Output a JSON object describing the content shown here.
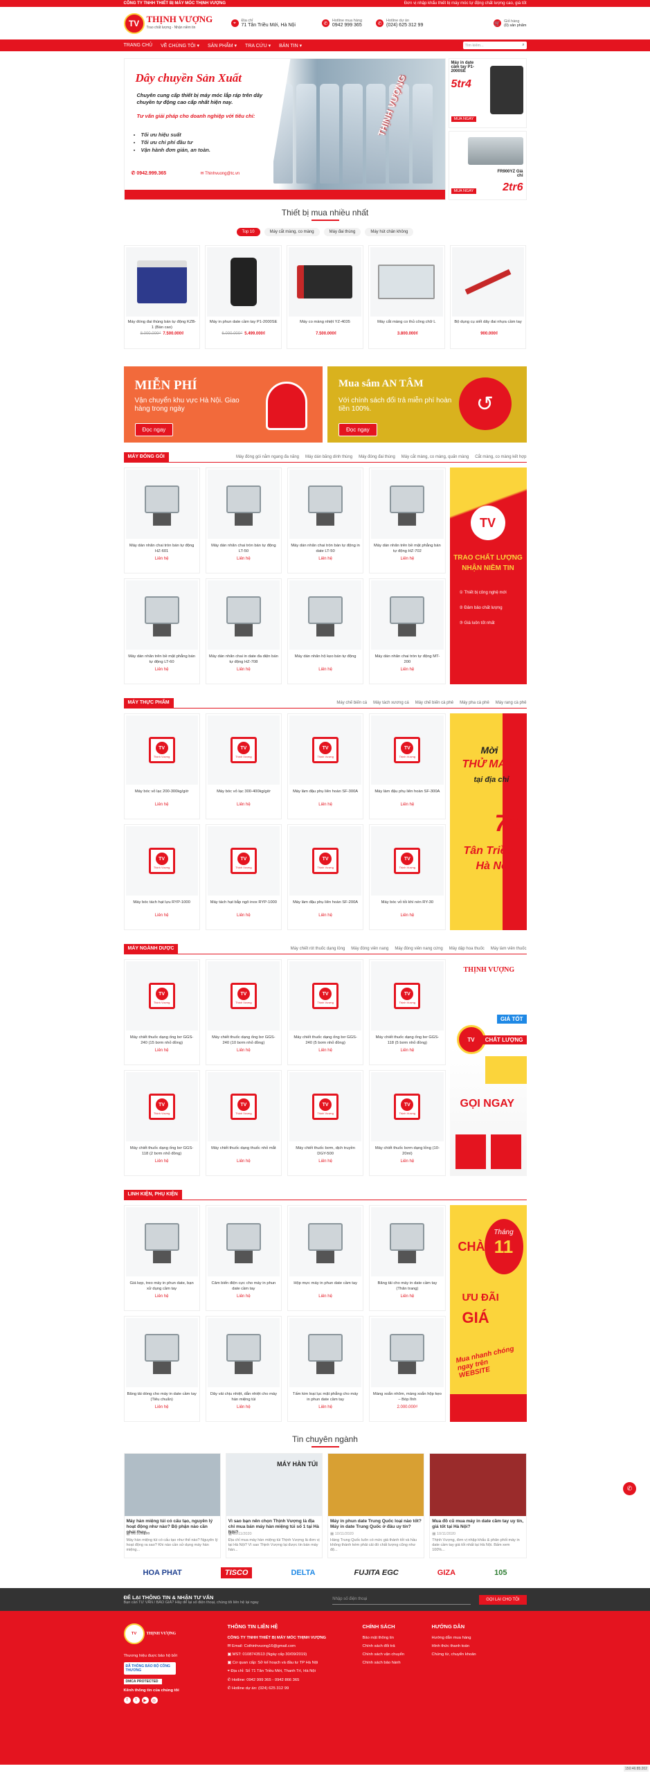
{
  "topbar": {
    "company": "CÔNG TY TNHH THIẾT BỊ MÁY MÓC THỊNH VƯỢNG",
    "slogan": "Đơn vị nhập khẩu thiết bị máy móc tự động chất lượng cao, giá tốt"
  },
  "logo": {
    "text": "THỊNH VƯỢNG",
    "sub": "Trao chất lượng - Nhận niềm tin"
  },
  "header": {
    "address_label": "Địa chỉ",
    "address": "71 Tân Triều Mới, Hà Nội",
    "hotline_label": "Hotline mua hàng",
    "hotline": "0942 999 365",
    "hotline2_label": "Hotline dự án",
    "hotline2": "(024) 625 312 99",
    "cart_label": "Giỏ hàng",
    "cart_count": "(0) sản phẩm"
  },
  "nav": {
    "items": [
      "TRANG CHỦ",
      "VỀ CHÚNG TÔI ▾",
      "SẢN PHẨM ▾",
      "TRA CỨU ▾",
      "BẢN TIN ▾"
    ],
    "search_placeholder": "Tìm kiếm..."
  },
  "banner": {
    "title": "Dây chuyền Sản Xuất",
    "desc1": "Chuyên cung cấp thiết bị máy móc lắp ráp trên dây chuyền tự động cao cấp nhất hiện nay.",
    "desc2": "Tư vấn giải pháp cho doanh nghiệp với tiêu chí:",
    "bullets": [
      "Tối ưu hiệu suất",
      "Tối ưu chi phí đầu tư",
      "Vận hành đơn giản, an toàn."
    ],
    "phone": "0942.999.365",
    "email": "Thinhvuong@tc.vn",
    "brand": "THỊNH VƯỢNG",
    "side1_title": "Máy in date cầm tay P1-2000SE",
    "side1_price": "5tr4",
    "side1_btn": "MUA NGAY",
    "side2_title": "FR900YZ Giá chỉ",
    "side2_price": "2tr6",
    "side2_btn": "MUA NGAY"
  },
  "best": {
    "title": "Thiết bị mua nhiều nhất",
    "tabs": [
      "Top 10",
      "Máy cắt màng, co màng",
      "Máy đai thùng",
      "Máy hút chân không"
    ],
    "items": [
      {
        "name": "Máy đóng đai thùng bán tự động KZB-1 (Bàn cao)",
        "old": "8.000.000₫",
        "price": "7.500.000₫"
      },
      {
        "name": "Máy in phun date cầm tay P1-2000SE",
        "old": "6.000.000₫",
        "price": "5.499.000₫"
      },
      {
        "name": "Máy co màng nhiệt YZ-4035",
        "old": "",
        "price": "7.500.000₫"
      },
      {
        "name": "Máy cắt màng co thủ công chữ L",
        "old": "",
        "price": "3.800.000₫"
      },
      {
        "name": "Bộ dụng cụ siết dây đai nhựa cầm tay",
        "old": "",
        "price": "900.000₫"
      }
    ]
  },
  "promo": {
    "a_title": "MIỄN PHÍ",
    "a_text": "Vận chuyển khu vực Hà Nội. Giao hàng trong ngày",
    "a_btn": "Đọc ngay",
    "b_title": "Mua sắm AN TÂM",
    "b_text": "Với chính sách đổi trả miễn phí hoàn tiền 100%.",
    "b_btn": "Đọc ngay"
  },
  "cat1": {
    "tag": "MÁY ĐÓNG GÓI",
    "links": [
      "Máy đóng gói nằm ngang đa năng",
      "Máy dán băng dính thùng",
      "Máy đóng đai thùng",
      "Máy cắt màng, co màng, quấn màng",
      "Cắt màng, co màng kết hợp"
    ],
    "items": [
      "Máy dán nhãn chai tròn bán tự động HZ-601",
      "Máy dán nhãn chai tròn bán tự động LT-50",
      "Máy dán nhãn chai tròn bán tự động in date LT-50",
      "Máy dán nhãn trên bề mặt phẳng bán tự động HZ-702",
      "Máy dán nhãn trên bề mặt phẳng bán tự động LT-60",
      "Máy dán nhãn chai in date đa diện bán tự động HZ-708",
      "Máy dán nhãn hộ kẹo bán tự động",
      "Máy dán nhãn chai tròn tự động MT-200"
    ],
    "price": "Liên hệ",
    "ad": {
      "t1": "TRAO CHẤT LƯỢNG",
      "t2": "NHẬN NIỀM TIN",
      "b": [
        "Thiết bị công nghệ mới",
        "Đảm bảo chất lượng",
        "Giá luôn tốt nhất"
      ]
    }
  },
  "cat2": {
    "tag": "MÁY THỰC PHẨM",
    "links": [
      "Máy chế biến cá",
      "Máy tách xương cá",
      "Máy chế biến cà phê",
      "Máy pha cà phê",
      "Máy rang cà phê"
    ],
    "items": [
      "Máy bóc vỏ lạc 200-300kg/giờ",
      "Máy bóc vỏ lạc 300-400kg/giờ",
      "Máy làm đậu phụ liên hoàn SF-300A",
      "Máy làm đậu phụ liên hoàn SF-300A",
      "Máy bóc tách hạt lựu RYP-1000",
      "Máy tách hạt bắp ngô inox RYP-1000",
      "Máy làm đậu phụ liên hoàn SF-200A",
      "Máy bóc vỏ tỏi khí nén RY-30"
    ],
    "price": "Liên hệ",
    "placeholder": "Thịnh Vượng",
    "ad": {
      "t1": "Mời",
      "t2": "THỬ MÁY",
      "t3": "tại địa chỉ",
      "t4": "71",
      "t5": "Tân Triều",
      "t6": "Hà Nội"
    }
  },
  "cat3": {
    "tag": "MÁY NGÀNH DƯỢC",
    "links": [
      "Máy chiết rót thuốc dạng lỏng",
      "Máy đóng viên nang",
      "Máy đóng viên nang cứng",
      "Máy dập hoa thuốc",
      "Máy làm viên thuốc"
    ],
    "items": [
      "Máy chiết thuốc dạng ống bơ GGS-240 (15 bơm nhỏ đồng)",
      "Máy chiết thuốc dạng ống bơ GGS-240 (10 bơm nhỏ đồng)",
      "Máy chiết thuốc dạng ống bơ GGS-240 (5 bơm nhỏ đồng)",
      "Máy chiết thuốc dạng ống bơ GGS-118 (5 bơm nhỏ đồng)",
      "Máy chiết thuốc dạng ống bơ GGS-118 (2 bơm nhỏ đồng)",
      "Máy chiết thuốc dạng thuốc nhỏ mắt",
      "Máy chiết thuốc bơm, dịch truyền DGY-500",
      "Máy chiết thuốc bơm dạng lỏng (10-20ml)"
    ],
    "price": "Liên hệ",
    "placeholder": "Thịnh Vượng",
    "ad": {
      "t1": "THỊNH VƯỢNG",
      "t2": "GIÁ TỐT",
      "t3": "CHẤT LƯỢNG",
      "t4": "GỌI NGAY"
    }
  },
  "cat4": {
    "tag": "LINH KIỆN, PHỤ KIỆN",
    "items": [
      {
        "name": "Giá kẹp, treo máy in phun date, bạn xử dụng cầm tay",
        "price": "Liên hệ"
      },
      {
        "name": "Cảm biến điện cực cho máy in phun date cầm tay",
        "price": "Liên hệ"
      },
      {
        "name": "Hộp mực máy in phun date cầm tay",
        "price": "Liên hệ"
      },
      {
        "name": "Băng tải cho máy in date cầm tay (Thân trang)",
        "price": "Liên hệ"
      },
      {
        "name": "Băng tải dòng cho máy in date cầm tay (Tiêu chuẩn)",
        "price": "Liên hệ"
      },
      {
        "name": "Dây vải chịu nhiệt, dẫn nhiệt cho máy hàn miệng túi",
        "price": "Liên hệ"
      },
      {
        "name": "Tấm kim loại lục mặt phẳng cho máy in phun date cầm tay",
        "price": "Liên hệ"
      },
      {
        "name": "Màng xoắn nhôm, màng xoắn hộp kẹo – Bóp lĩnh",
        "price": "2.000.000₫"
      }
    ],
    "ad": {
      "t1": "CHÀO",
      "t2": "Tháng",
      "t3": "11",
      "t4": "ƯU ĐÃI",
      "t5": "GIÁ",
      "t6": "Mua nhanh chóng ngay trên WEBSITE"
    }
  },
  "news": {
    "title": "Tin chuyên ngành",
    "items": [
      {
        "title": "Máy hàn miệng túi có cấu tạo, nguyên lý hoạt động như nào? Bộ phận nào cần phải thay...",
        "date": "10/11/2020",
        "excerpt": "Máy hàn miệng túi có cấu tạo như thế nào? Nguyên lý hoạt động ra sao? Khi nào cần sử dụng máy hàn miệng..."
      },
      {
        "title": "Vì sao bạn nên chọn Thịnh Vượng là địa chỉ mua bán máy hàn miệng túi số 1 tại Hà Nội?",
        "date": "10/11/2020",
        "excerpt": "Địa chỉ mua máy hàn miệng túi Thịnh Vượng là đơn vị tại Hà Nội? Vì sao Thịnh Vượng lại được tin bán máy hàn..."
      },
      {
        "title": "Máy in phun date Trung Quốc loại nào tốt? Máy in date Trung Quốc ở đâu uy tín?",
        "date": "10/11/2020",
        "excerpt": "Hàng Trung Quốc luôn có mức giá thành tốt và hầu không thành kém phải cải đó chất lượng cũng như độ..."
      },
      {
        "title": "Mua đồ cũ mua máy in date cầm tay uy tín, giá tốt tại Hà Nội?",
        "date": "10/11/2020",
        "excerpt": "Thịnh Vượng, đơn vị nhập khẩu & phân phối máy in date cầm tay giá tốt nhất tại Hà Nội. Bấm xem 100%..."
      }
    ],
    "img_text": "MÁY HÀN TÚI"
  },
  "brands": [
    "HOA PHAT",
    "TISCO",
    "DELTA",
    "FUJITA EGC",
    "GIZA",
    "105"
  ],
  "newsletter": {
    "title": "ĐỂ LẠI THÔNG TIN & NHẬN TƯ VẤN",
    "sub": "Bạn cần TƯ VẤN / BÁO GIÁ? Hãy để lại số điện thoại, chúng tôi liên hệ lại ngay",
    "placeholder": "Nhập số điện thoại",
    "button": "GỌI LẠI CHO TÔI"
  },
  "footer": {
    "tagline": "Thương hiệu đuợc bảo hộ bởi",
    "bct": "ĐÃ THÔNG BÁO BỘ CÔNG THƯƠNG",
    "dmca": "DMCA PROTECTED",
    "connect": "Kênh thông tin của chúng tôi",
    "c2_title": "THÔNG TIN LIÊN HỆ",
    "c2_company": "CÔNG TY TNHH THIẾT BỊ MÁY MÓC THỊNH VƯỢNG",
    "c2_lines": [
      "Email: Csthinhvuong16@gmail.com",
      "MST: 0108743513 (Ngày cấp 30/09/2019)",
      "Cơ quan cấp: Sở kế hoạch và đầu tư TP Hà Nội",
      "Địa chỉ: Số 71 Tân Triều Mới, Thanh Trì, Hà Nội",
      "Hotline: 0942 999 365 - 0942 866 365",
      "Hotline dự án: (024) 625 312 99"
    ],
    "c3_title": "CHÍNH SÁCH",
    "c3_lines": [
      "Bảo mật thông tin",
      "Chính sách đổi trả",
      "Chính sách vận chuyển",
      "Chính sách bảo hành"
    ],
    "c4_title": "HƯỚNG DẪN",
    "c4_lines": [
      "Hướng dẫn mua hàng",
      "Hình thức thanh toán",
      "Chứng từ, chuyển khoản"
    ]
  },
  "copyright": "150:46:85:202",
  "colors": {
    "primary": "#e4141f",
    "accent": "#fbd43b",
    "dark": "#333333"
  }
}
